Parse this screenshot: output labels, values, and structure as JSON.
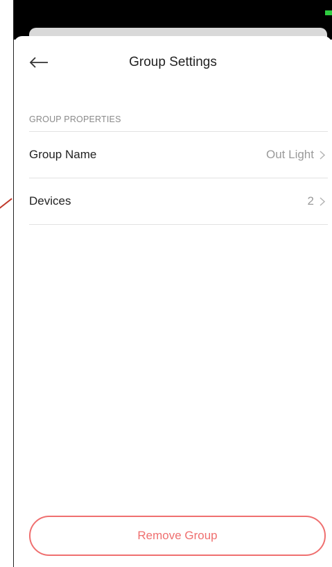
{
  "header": {
    "title": "Group Settings",
    "back_icon": "arrow-left-icon"
  },
  "section": {
    "header": "GROUP PROPERTIES"
  },
  "rows": [
    {
      "label": "Group Name",
      "value": "Out Light",
      "icon": "chevron-right-icon"
    },
    {
      "label": "Devices",
      "value": "2",
      "icon": "chevron-right-icon"
    }
  ],
  "actions": {
    "remove_label": "Remove Group"
  },
  "colors": {
    "accent_danger": "#ef6f6f",
    "text_primary": "#222222",
    "text_secondary": "#9a9a9a",
    "battery": "#2ecc40"
  }
}
